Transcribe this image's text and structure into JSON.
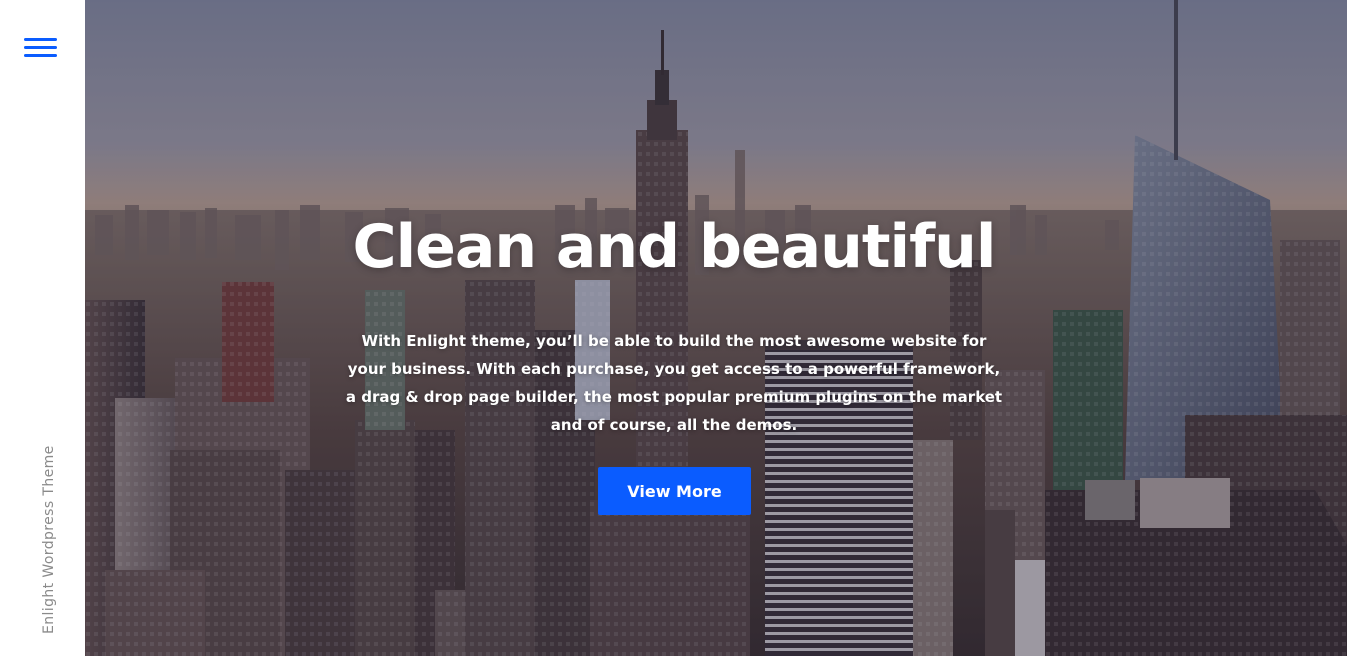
{
  "sidebar": {
    "menu_icon": "hamburger-menu-icon",
    "vertical_text": "Enlight Wordpress Theme"
  },
  "hero": {
    "title": "Clean and beautiful",
    "description": "With Enlight theme, you’ll be able to build the most awesome website for your business. With each purchase, you get access to a powerful framework, a drag & drop page builder, the most popular premium plugins on the market and of course, all the demos.",
    "button_label": "View More",
    "background": "city-skyline-photo"
  },
  "colors": {
    "accent": "#0a5cff",
    "sidebar_bg": "#ffffff",
    "sidebar_text": "#8a8a8a",
    "hero_text": "#ffffff"
  }
}
